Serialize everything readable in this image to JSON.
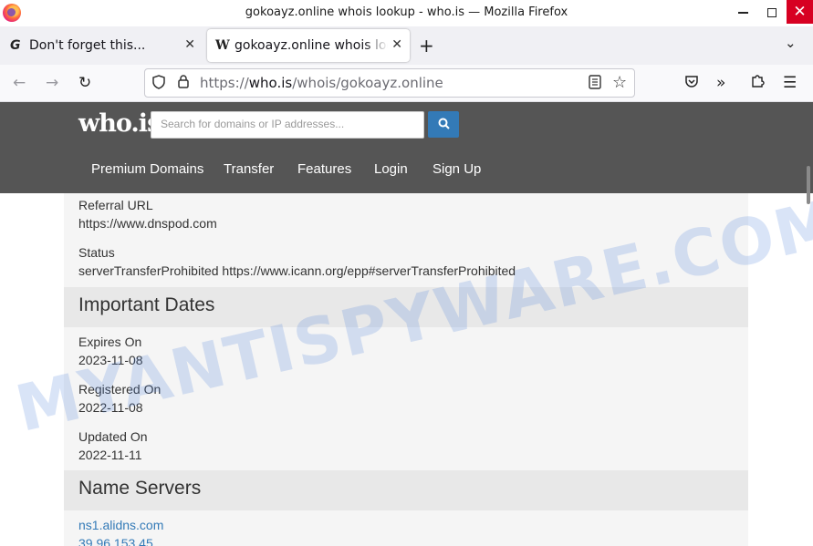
{
  "window": {
    "title": "gokoayz.online whois lookup - who.is — Mozilla Firefox",
    "minimize": "",
    "maximize": "",
    "close": "✕"
  },
  "tabs": [
    {
      "icon": "G",
      "title": "Don't forget this...",
      "close": "✕"
    },
    {
      "icon": "W",
      "title": "gokoayz.online whois lookup - who.is",
      "close": "✕"
    }
  ],
  "tabstrip": {
    "new_tab": "+",
    "list_all": "⌄"
  },
  "urlbar": {
    "scheme": "https://",
    "host": "who.is",
    "path": "/whois/gokoayz.online"
  },
  "site": {
    "logo": "who.is",
    "search_placeholder": "Search for domains or IP addresses...",
    "nav": [
      "Premium Domains",
      "Transfer",
      "Features",
      "Login",
      "Sign Up"
    ]
  },
  "registrar_info": {
    "referral_url_label": "Referral URL",
    "referral_url_value": "https://www.dnspod.com",
    "status_label": "Status",
    "status_value": "serverTransferProhibited https://www.icann.org/epp#serverTransferProhibited"
  },
  "important_dates": {
    "heading": "Important Dates",
    "expires_label": "Expires On",
    "expires_value": "2023-11-08",
    "registered_label": "Registered On",
    "registered_value": "2022-11-08",
    "updated_label": "Updated On",
    "updated_value": "2022-11-11"
  },
  "name_servers": {
    "heading": "Name Servers",
    "entries": [
      "ns1.alidns.com",
      "39.96.153.45"
    ]
  },
  "watermark": "MYANTISPYWARE.COM"
}
